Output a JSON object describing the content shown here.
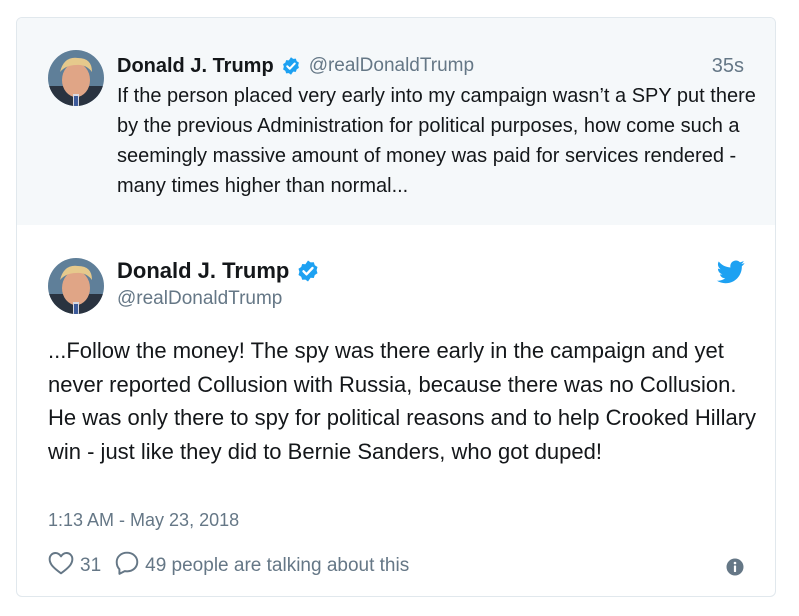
{
  "parent_tweet": {
    "display_name": "Donald J. Trump",
    "handle": "@realDonaldTrump",
    "time_ago": "35s",
    "text": "If the person placed very early into my campaign wasn’t a SPY put there by the previous Administration for political purposes, how come such a seemingly massive amount of money was paid for services rendered - many times higher than normal..."
  },
  "tweet": {
    "display_name": "Donald J. Trump",
    "handle": "@realDonaldTrump",
    "text": "...Follow the money! The spy was there early in the campaign and yet never reported Collusion with Russia, because there was no Collusion. He was only there to spy for political reasons and to help Crooked Hillary win - just like they did to Bernie Sanders, who got duped!",
    "timestamp": "1:13 AM - May 23, 2018",
    "likes": "31",
    "talking": "49 people are talking about this"
  },
  "icons": {
    "verified": "verified-badge-icon",
    "brand": "twitter-bird-icon",
    "like": "heart-icon",
    "reply": "speech-bubble-icon",
    "info": "info-icon"
  },
  "colors": {
    "accent": "#1da1f2",
    "text": "#14171a",
    "muted": "#657786",
    "parent_background": "#f5f8fa",
    "border": "#e1e8ed"
  }
}
